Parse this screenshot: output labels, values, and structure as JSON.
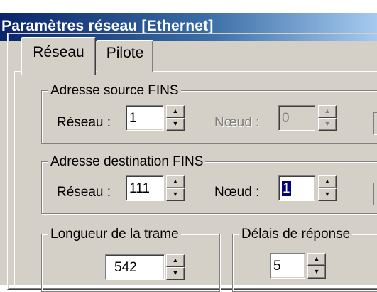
{
  "window": {
    "title": "Paramètres réseau [Ethernet]"
  },
  "tabs": [
    {
      "label": "Réseau",
      "active": true
    },
    {
      "label": "Pilote",
      "active": false
    }
  ],
  "source_group": {
    "legend": "Adresse source FINS",
    "network_label": "Réseau :",
    "network_value": "1",
    "node_label": "Nœud :",
    "node_value": "0",
    "node_enabled": false
  },
  "dest_group": {
    "legend": "Adresse destination FINS",
    "network_label": "Réseau :",
    "network_value": "111",
    "node_label": "Nœud :",
    "node_value": "1",
    "node_enabled": true
  },
  "frame_group": {
    "legend": "Longueur de la trame",
    "value": "542"
  },
  "response_group": {
    "legend": "Délais de réponse",
    "value": "5"
  },
  "icons": {
    "spin_up": "▲",
    "spin_down": "▼"
  },
  "colors": {
    "title_start": "#0a246a",
    "title_end": "#a6caf0",
    "face": "#d4d0c8",
    "selection": "#000080"
  }
}
